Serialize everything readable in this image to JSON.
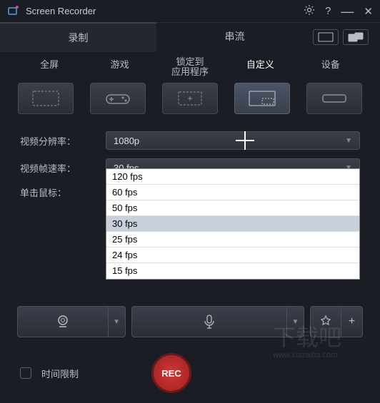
{
  "titlebar": {
    "title": "Screen Recorder"
  },
  "top_tabs": {
    "record": "录制",
    "stream": "串流"
  },
  "modes": {
    "fullscreen": "全屏",
    "game": "游戏",
    "app_lock_line1": "锁定到",
    "app_lock_line2": "应用程序",
    "custom": "自定义",
    "device": "设备"
  },
  "settings": {
    "resolution_label": "视频分辨率：",
    "resolution_value": "1080p",
    "framerate_label": "视频帧速率：",
    "framerate_value": "30 fps",
    "mouse_label": "单击鼠标："
  },
  "fps_options": [
    "120 fps",
    "60 fps",
    "50 fps",
    "30 fps",
    "25 fps",
    "24 fps",
    "15 fps"
  ],
  "footer": {
    "time_limit": "时间限制",
    "rec": "REC"
  },
  "watermark": {
    "text": "下载吧",
    "url": "www.xiazaiba.com"
  }
}
